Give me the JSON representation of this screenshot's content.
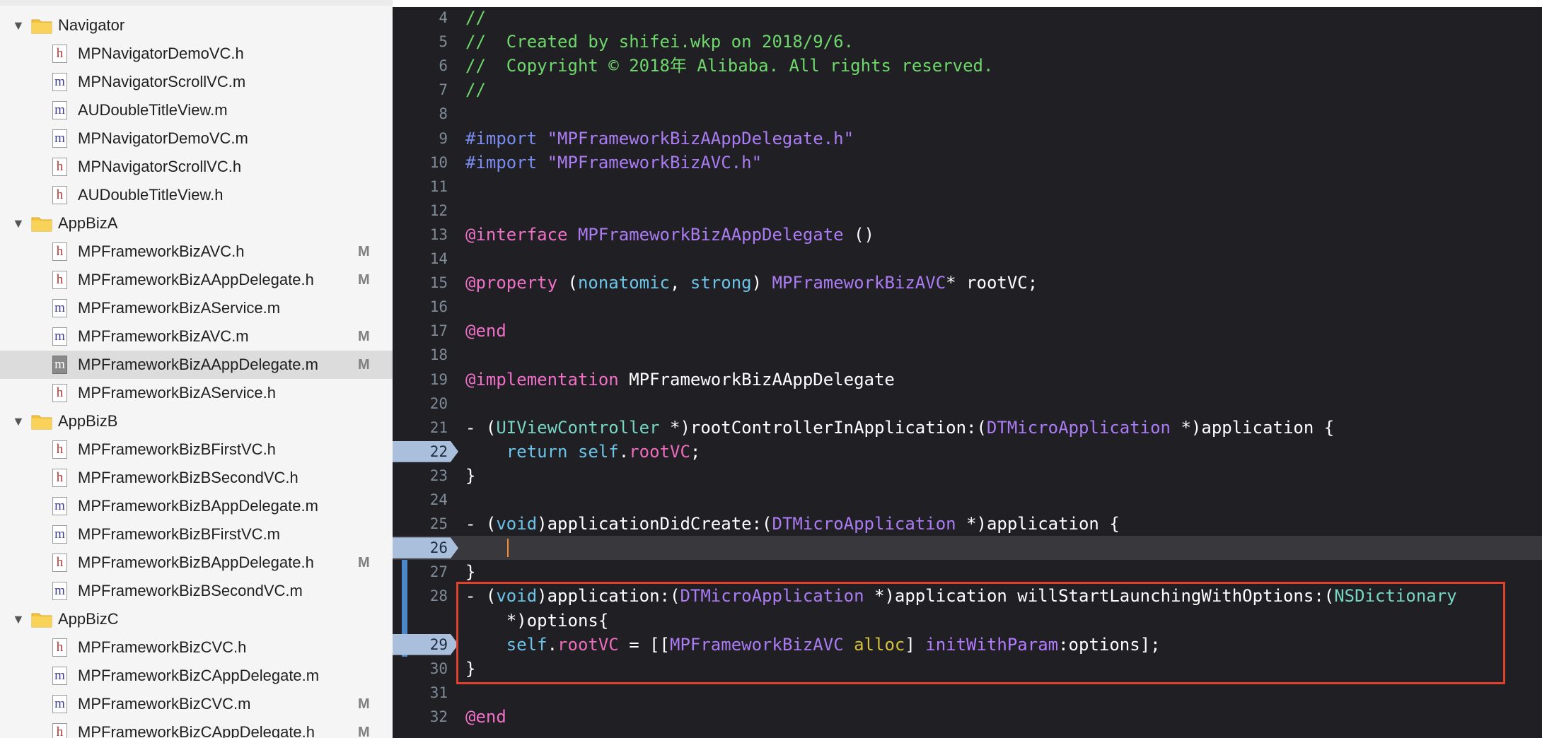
{
  "navigator": {
    "items": [
      {
        "kind": "group",
        "label": "Navigator"
      },
      {
        "kind": "file",
        "type": "h",
        "label": "MPNavigatorDemoVC.h",
        "badge": ""
      },
      {
        "kind": "file",
        "type": "m",
        "label": "MPNavigatorScrollVC.m",
        "badge": ""
      },
      {
        "kind": "file",
        "type": "m",
        "label": "AUDoubleTitleView.m",
        "badge": ""
      },
      {
        "kind": "file",
        "type": "m",
        "label": "MPNavigatorDemoVC.m",
        "badge": ""
      },
      {
        "kind": "file",
        "type": "h",
        "label": "MPNavigatorScrollVC.h",
        "badge": ""
      },
      {
        "kind": "file",
        "type": "h",
        "label": "AUDoubleTitleView.h",
        "badge": ""
      },
      {
        "kind": "group",
        "label": "AppBizA"
      },
      {
        "kind": "file",
        "type": "h",
        "label": "MPFrameworkBizAVC.h",
        "badge": "M"
      },
      {
        "kind": "file",
        "type": "h",
        "label": "MPFrameworkBizAAppDelegate.h",
        "badge": "M"
      },
      {
        "kind": "file",
        "type": "m",
        "label": "MPFrameworkBizAService.m",
        "badge": ""
      },
      {
        "kind": "file",
        "type": "m",
        "label": "MPFrameworkBizAVC.m",
        "badge": "M"
      },
      {
        "kind": "file",
        "type": "m",
        "label": "MPFrameworkBizAAppDelegate.m",
        "badge": "M",
        "selected": true
      },
      {
        "kind": "file",
        "type": "h",
        "label": "MPFrameworkBizAService.h",
        "badge": ""
      },
      {
        "kind": "group",
        "label": "AppBizB"
      },
      {
        "kind": "file",
        "type": "h",
        "label": "MPFrameworkBizBFirstVC.h",
        "badge": ""
      },
      {
        "kind": "file",
        "type": "h",
        "label": "MPFrameworkBizBSecondVC.h",
        "badge": ""
      },
      {
        "kind": "file",
        "type": "m",
        "label": "MPFrameworkBizBAppDelegate.m",
        "badge": ""
      },
      {
        "kind": "file",
        "type": "m",
        "label": "MPFrameworkBizBFirstVC.m",
        "badge": ""
      },
      {
        "kind": "file",
        "type": "h",
        "label": "MPFrameworkBizBAppDelegate.h",
        "badge": "M"
      },
      {
        "kind": "file",
        "type": "m",
        "label": "MPFrameworkBizBSecondVC.m",
        "badge": ""
      },
      {
        "kind": "group",
        "label": "AppBizC"
      },
      {
        "kind": "file",
        "type": "h",
        "label": "MPFrameworkBizCVC.h",
        "badge": ""
      },
      {
        "kind": "file",
        "type": "m",
        "label": "MPFrameworkBizCAppDelegate.m",
        "badge": ""
      },
      {
        "kind": "file",
        "type": "m",
        "label": "MPFrameworkBizCVC.m",
        "badge": "M"
      },
      {
        "kind": "file",
        "type": "h",
        "label": "MPFrameworkBizCAppDelegate.h",
        "badge": "M"
      }
    ]
  },
  "editor": {
    "breakpoints": [
      22,
      26,
      29
    ],
    "current_line": 26,
    "highlighted_lines": [
      28,
      29,
      30
    ],
    "lines": [
      {
        "n": "4",
        "tokens": [
          {
            "c": "comment",
            "t": "//"
          }
        ]
      },
      {
        "n": "5",
        "tokens": [
          {
            "c": "comment",
            "t": "//  Created by shifei.wkp on 2018/9/6."
          }
        ]
      },
      {
        "n": "6",
        "tokens": [
          {
            "c": "comment",
            "t": "//  Copyright © 2018年 Alibaba. All rights reserved."
          }
        ]
      },
      {
        "n": "7",
        "tokens": [
          {
            "c": "comment",
            "t": "//"
          }
        ]
      },
      {
        "n": "8",
        "tokens": []
      },
      {
        "n": "9",
        "tokens": [
          {
            "c": "pre",
            "t": "#import "
          },
          {
            "c": "str",
            "t": "\"MPFrameworkBizAAppDelegate.h\""
          }
        ]
      },
      {
        "n": "10",
        "tokens": [
          {
            "c": "pre",
            "t": "#import "
          },
          {
            "c": "str",
            "t": "\"MPFrameworkBizAVC.h\""
          }
        ]
      },
      {
        "n": "11",
        "tokens": []
      },
      {
        "n": "12",
        "tokens": []
      },
      {
        "n": "13",
        "tokens": [
          {
            "c": "kw",
            "t": "@interface"
          },
          {
            "c": "pl",
            "t": " "
          },
          {
            "c": "type",
            "t": "MPFrameworkBizAAppDelegate"
          },
          {
            "c": "pl",
            "t": " ()"
          }
        ]
      },
      {
        "n": "14",
        "tokens": []
      },
      {
        "n": "15",
        "tokens": [
          {
            "c": "kw",
            "t": "@property"
          },
          {
            "c": "pl",
            "t": " ("
          },
          {
            "c": "attr",
            "t": "nonatomic"
          },
          {
            "c": "pl",
            "t": ", "
          },
          {
            "c": "attr",
            "t": "strong"
          },
          {
            "c": "pl",
            "t": ") "
          },
          {
            "c": "type",
            "t": "MPFrameworkBizAVC"
          },
          {
            "c": "pl",
            "t": "* rootVC;"
          }
        ]
      },
      {
        "n": "16",
        "tokens": []
      },
      {
        "n": "17",
        "tokens": [
          {
            "c": "kw",
            "t": "@end"
          }
        ]
      },
      {
        "n": "18",
        "tokens": []
      },
      {
        "n": "19",
        "tokens": [
          {
            "c": "kw",
            "t": "@implementation"
          },
          {
            "c": "pl",
            "t": " MPFrameworkBizAAppDelegate"
          }
        ]
      },
      {
        "n": "20",
        "tokens": []
      },
      {
        "n": "21",
        "tokens": [
          {
            "c": "pl",
            "t": "- ("
          },
          {
            "c": "ns",
            "t": "UIViewController"
          },
          {
            "c": "pl",
            "t": " *)rootControllerInApplication:("
          },
          {
            "c": "type",
            "t": "DTMicroApplication"
          },
          {
            "c": "pl",
            "t": " *)application {"
          }
        ]
      },
      {
        "n": "22",
        "tokens": [
          {
            "c": "pl",
            "t": "    "
          },
          {
            "c": "self",
            "t": "return"
          },
          {
            "c": "pl",
            "t": " "
          },
          {
            "c": "self",
            "t": "self"
          },
          {
            "c": "pl",
            "t": "."
          },
          {
            "c": "prop",
            "t": "rootVC"
          },
          {
            "c": "pl",
            "t": ";"
          }
        ]
      },
      {
        "n": "23",
        "tokens": [
          {
            "c": "pl",
            "t": "}"
          }
        ]
      },
      {
        "n": "24",
        "tokens": []
      },
      {
        "n": "25",
        "tokens": [
          {
            "c": "pl",
            "t": "- ("
          },
          {
            "c": "attr",
            "t": "void"
          },
          {
            "c": "pl",
            "t": ")applicationDidCreate:("
          },
          {
            "c": "type",
            "t": "DTMicroApplication"
          },
          {
            "c": "pl",
            "t": " *)application {"
          }
        ]
      },
      {
        "n": "26",
        "tokens": []
      },
      {
        "n": "27",
        "tokens": [
          {
            "c": "pl",
            "t": "}"
          }
        ]
      },
      {
        "n": "28",
        "tokens": [
          {
            "c": "pl",
            "t": "- ("
          },
          {
            "c": "attr",
            "t": "void"
          },
          {
            "c": "pl",
            "t": ")application:("
          },
          {
            "c": "type",
            "t": "DTMicroApplication"
          },
          {
            "c": "pl",
            "t": " *)application willStartLaunchingWithOptions:("
          },
          {
            "c": "ns",
            "t": "NSDictionary"
          }
        ]
      },
      {
        "n": "",
        "tokens": [
          {
            "c": "pl",
            "t": "    *)options{"
          }
        ]
      },
      {
        "n": "29",
        "tokens": [
          {
            "c": "pl",
            "t": "    "
          },
          {
            "c": "self",
            "t": "self"
          },
          {
            "c": "pl",
            "t": "."
          },
          {
            "c": "prop",
            "t": "rootVC"
          },
          {
            "c": "pl",
            "t": " = [["
          },
          {
            "c": "type",
            "t": "MPFrameworkBizAVC"
          },
          {
            "c": "pl",
            "t": " "
          },
          {
            "c": "meth",
            "t": "alloc"
          },
          {
            "c": "pl",
            "t": "] "
          },
          {
            "c": "msg",
            "t": "initWithParam"
          },
          {
            "c": "pl",
            "t": ":options];"
          }
        ]
      },
      {
        "n": "30",
        "tokens": [
          {
            "c": "pl",
            "t": "}"
          }
        ]
      },
      {
        "n": "31",
        "tokens": []
      },
      {
        "n": "32",
        "tokens": [
          {
            "c": "kw",
            "t": "@end"
          }
        ]
      }
    ]
  }
}
